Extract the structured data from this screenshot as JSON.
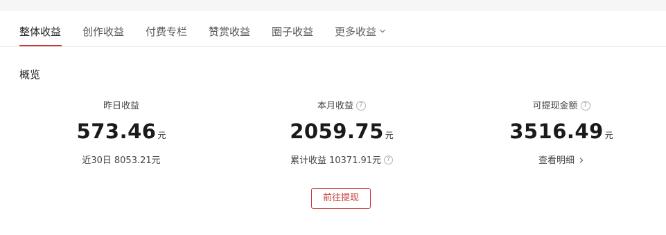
{
  "tabs": [
    {
      "label": "整体收益",
      "active": true
    },
    {
      "label": "创作收益",
      "active": false
    },
    {
      "label": "付费专栏",
      "active": false
    },
    {
      "label": "赞赏收益",
      "active": false
    },
    {
      "label": "圈子收益",
      "active": false
    },
    {
      "label": "更多收益",
      "active": false
    }
  ],
  "overview": {
    "title": "概览",
    "yesterday": {
      "label": "昨日收益",
      "value": "573.46",
      "unit": "元",
      "sub_label": "近30日",
      "sub_value": "8053.21元"
    },
    "month": {
      "label": "本月收益",
      "value": "2059.75",
      "unit": "元",
      "sub_label": "累计收益",
      "sub_value": "10371.91元"
    },
    "withdrawable": {
      "label": "可提现金额",
      "value": "3516.49",
      "unit": "元",
      "link_label": "查看明细"
    }
  },
  "withdraw_button": "前往提现",
  "icons": {
    "help": "question-circle-icon",
    "more_tabs": "chevron-down-icon",
    "detail_link": "chevron-right-icon"
  },
  "colors": {
    "accent": "#c8383a",
    "background": "#f6f6f6",
    "card": "#ffffff"
  }
}
